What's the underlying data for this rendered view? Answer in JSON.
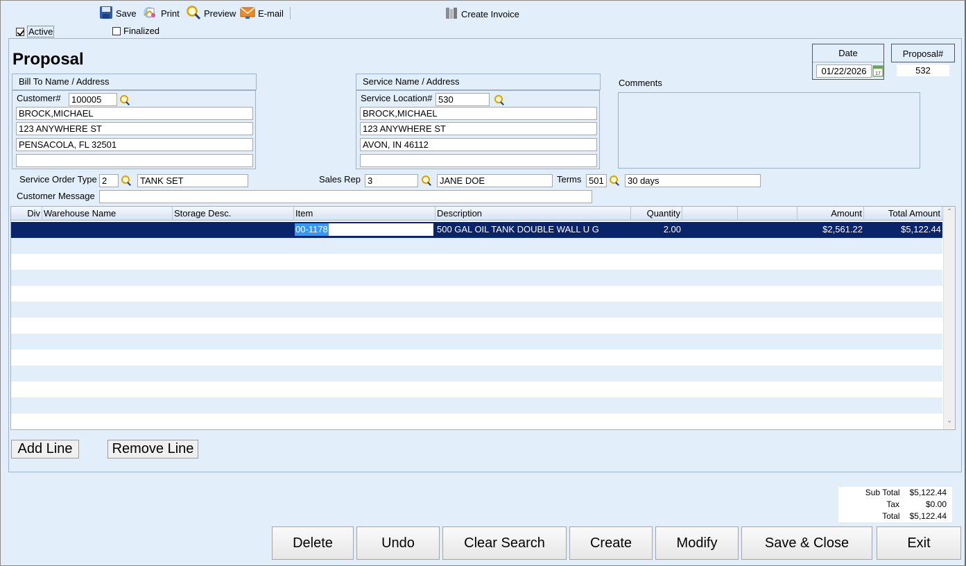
{
  "toolbar": {
    "save": "Save",
    "print": "Print",
    "preview": "Preview",
    "email": "E-mail",
    "create_invoice": "Create Invoice"
  },
  "flags": {
    "active_label": "Active",
    "active_checked": true,
    "finalized_label": "Finalized",
    "finalized_checked": false
  },
  "page_title": "Proposal",
  "date": {
    "label": "Date",
    "value": "01/22/2026"
  },
  "proposal": {
    "label": "Proposal#",
    "value": "532"
  },
  "bill_to": {
    "title": "Bill To Name / Address",
    "customer_label": "Customer#",
    "customer_value": "100005",
    "name": "BROCK,MICHAEL",
    "address1": "123 ANYWHERE ST",
    "address2": "PENSACOLA, FL  32501",
    "address3": ""
  },
  "service": {
    "title": "Service Name / Address",
    "location_label": "Service Location#",
    "location_value": "530",
    "name": "BROCK,MICHAEL",
    "address1": "123 ANYWHERE ST",
    "address2": "AVON, IN  46112",
    "address3": ""
  },
  "comments": {
    "label": "Comments",
    "value": ""
  },
  "order_type": {
    "label": "Service Order Type",
    "code": "2",
    "name": "TANK SET"
  },
  "sales_rep": {
    "label": "Sales Rep",
    "code": "3",
    "name": "JANE DOE"
  },
  "terms": {
    "label": "Terms",
    "code": "501",
    "name": "30 days"
  },
  "customer_message": {
    "label": "Customer Message",
    "value": ""
  },
  "grid": {
    "columns": [
      "Div",
      "Warehouse Name",
      "Storage Desc.",
      "Item",
      "Description",
      "Quantity",
      "",
      "",
      "Amount",
      "Total Amount"
    ],
    "rows": [
      {
        "div": "",
        "warehouse": "",
        "storage": "",
        "item": "00-1178",
        "description": "500 GAL OIL TANK DOUBLE WALL U G",
        "quantity": "2.00",
        "c7": "",
        "c8": "",
        "amount": "$2,561.22",
        "total": "$5,122.44"
      }
    ]
  },
  "line_buttons": {
    "add": "Add Line",
    "remove": "Remove Line"
  },
  "totals": {
    "subtotal_label": "Sub Total",
    "subtotal": "$5,122.44",
    "tax_label": "Tax",
    "tax": "$0.00",
    "total_label": "Total",
    "total": "$5,122.44"
  },
  "actions": {
    "delete": "Delete",
    "undo": "Undo",
    "clear_search": "Clear Search",
    "create": "Create",
    "modify": "Modify",
    "save_close": "Save & Close",
    "exit": "Exit"
  },
  "colors": {
    "background": "#e3eefb",
    "selected_row": "#0a246a",
    "border": "#9db0c8"
  }
}
